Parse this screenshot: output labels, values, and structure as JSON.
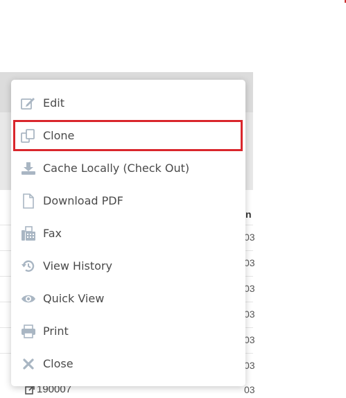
{
  "menu": {
    "items": [
      {
        "label": "Edit",
        "icon": "edit-icon"
      },
      {
        "label": "Clone",
        "icon": "clone-icon",
        "highlighted": true
      },
      {
        "label": "Cache Locally (Check Out)",
        "icon": "download-icon"
      },
      {
        "label": "Download PDF",
        "icon": "document-icon"
      },
      {
        "label": "Fax",
        "icon": "fax-icon"
      },
      {
        "label": "View History",
        "icon": "history-icon"
      },
      {
        "label": "Quick View",
        "icon": "eye-icon"
      },
      {
        "label": "Print",
        "icon": "print-icon"
      },
      {
        "label": "Close",
        "icon": "close-icon"
      }
    ]
  },
  "background": {
    "column_header_fragment": "n",
    "row_code_fragment": "03",
    "bottom_row_id": "190007",
    "bottom_row_code": "03"
  },
  "colors": {
    "highlight": "#d9262c",
    "icon": "#a9b6c3",
    "text": "#4a4a4a"
  }
}
